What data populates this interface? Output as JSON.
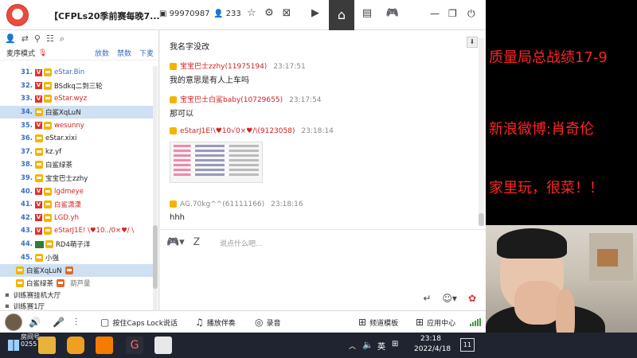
{
  "titlebar": {
    "room_title": "【CFPLs20季前赛每晚7...",
    "room_id": "99970987",
    "viewer_count": "233",
    "icons": [
      "person-icon",
      "star-icon",
      "settings-icon",
      "close-circle-icon",
      "video-icon",
      "home-icon",
      "list-icon",
      "gamepad-icon",
      "minimize-icon",
      "maximize-icon",
      "power-icon"
    ]
  },
  "left_panel": {
    "mode_label": "麦序模式",
    "links": [
      "放数",
      "禁数",
      "下麦"
    ],
    "seats": [
      {
        "num": "31.",
        "name": "eStar.Bin",
        "v": true,
        "style": "blue"
      },
      {
        "num": "32.",
        "name": "BSdkq二到三轮",
        "v": true,
        "style": "dark"
      },
      {
        "num": "33.",
        "name": "eStar.wyz",
        "v": true,
        "style": "red"
      },
      {
        "num": "34.",
        "name": "白鲨XqLuN",
        "v": false,
        "style": "dark",
        "selected": true
      },
      {
        "num": "35.",
        "name": "wesunny",
        "v": true,
        "style": "red"
      },
      {
        "num": "36.",
        "name": "eStar.xixi",
        "v": false,
        "style": "dark"
      },
      {
        "num": "37.",
        "name": "kz.yf",
        "v": false,
        "style": "dark"
      },
      {
        "num": "38.",
        "name": "白鲨绿茶",
        "v": false,
        "style": "dark"
      },
      {
        "num": "39.",
        "name": "宝宝巴士zzhy",
        "v": false,
        "style": "dark"
      },
      {
        "num": "40.",
        "name": "lgdmeye",
        "v": true,
        "style": "red"
      },
      {
        "num": "41.",
        "name": "白鲨潇潇",
        "v": true,
        "style": "red"
      },
      {
        "num": "42.",
        "name": "LGD.yh",
        "v": true,
        "style": "red"
      },
      {
        "num": "43.",
        "name": "eStarJ1E! \\♥10../0×♥/ \\",
        "v": true,
        "style": "red"
      },
      {
        "num": "44.",
        "name": "RD4萌子洋",
        "v": false,
        "style": "dark",
        "green": true
      },
      {
        "num": "45.",
        "name": "小强",
        "v": false,
        "style": "dark"
      }
    ],
    "sub_items": [
      {
        "name": "白鲨XqLuN",
        "extra": "",
        "gray": "",
        "selected": true
      },
      {
        "name": "白鲨绿茶",
        "extra": "",
        "gray": "葫芦量",
        "selected": false
      }
    ],
    "halls": [
      "训练赛挂机大厅",
      "训练赛1厅"
    ]
  },
  "chat": {
    "messages": [
      {
        "sender": "宝宝巴士zzhy(11975194)",
        "time": "23:17:51",
        "text": "我的意思是有人上车吗"
      },
      {
        "sender": "宝宝巴士白鲨baby(10729655)",
        "time": "23:17:54",
        "text": "那可以"
      },
      {
        "sender": "eStarJ1E!\\♥10√0×♥/\\(9123058)",
        "time": "23:18:14",
        "text": ""
      },
      {
        "sender": "AG.70kg^^(61111166)",
        "time": "23:18:16",
        "text": "hhh"
      }
    ],
    "top_text": "我名字没改",
    "input_placeholder": "说点什么吧..."
  },
  "toolbar": {
    "caps_lock_label": "按住Caps Lock说话",
    "music_label": "播放伴奏",
    "record_label": "录音",
    "channel_label": "频道模板",
    "app_center_label": "应用中心"
  },
  "overlay": {
    "line1": "质量局总战绩17-9",
    "line2": "新浪微博:肖奇伦",
    "line3": "家里玩，很菜！！",
    "color": "#ff2424"
  },
  "taskbar": {
    "label_top": "房间号",
    "label_bottom": "0255",
    "ime": "英",
    "time": "23:18",
    "date": "2022/4/18",
    "notif_count": "11"
  }
}
